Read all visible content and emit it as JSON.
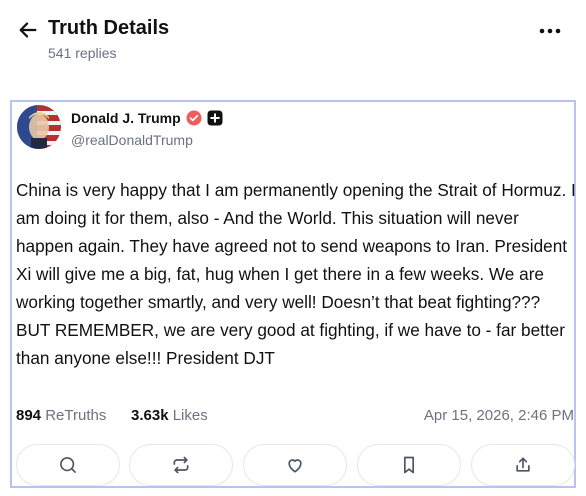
{
  "header": {
    "title": "Truth Details",
    "replies": "541 replies"
  },
  "post": {
    "author": {
      "display_name": "Donald J. Trump",
      "handle": "@realDonaldTrump"
    },
    "text": "China is very happy that I am permanently opening the Strait of Hormuz. I am doing it for them, also - And the World. This situation will never happen again. They have agreed not to send weapons to Iran. President Xi will give me a big, fat, hug when I get there in a few weeks. We are working together smartly, and very well! Doesn’t that beat fighting??? BUT REMEMBER, we are very good at fighting, if we have to - far better than anyone else!!! President DJT",
    "stats": {
      "retruths_count": "894",
      "retruths_label": "ReTruths",
      "likes_count": "3.63k",
      "likes_label": "Likes"
    },
    "timestamp": "Apr 15, 2026, 2:46 PM"
  },
  "colors": {
    "accent_border": "#b9c3f2",
    "verified": "#f25b5b",
    "muted_text": "#6b7280"
  },
  "icons": {
    "back": "arrow-left-icon",
    "more": "more-horizontal-icon",
    "verified": "verified-badge-icon",
    "plus": "plus-badge-icon",
    "reply": "comment-icon",
    "retruth": "repost-icon",
    "like": "heart-icon",
    "bookmark": "bookmark-icon",
    "share": "share-icon"
  }
}
